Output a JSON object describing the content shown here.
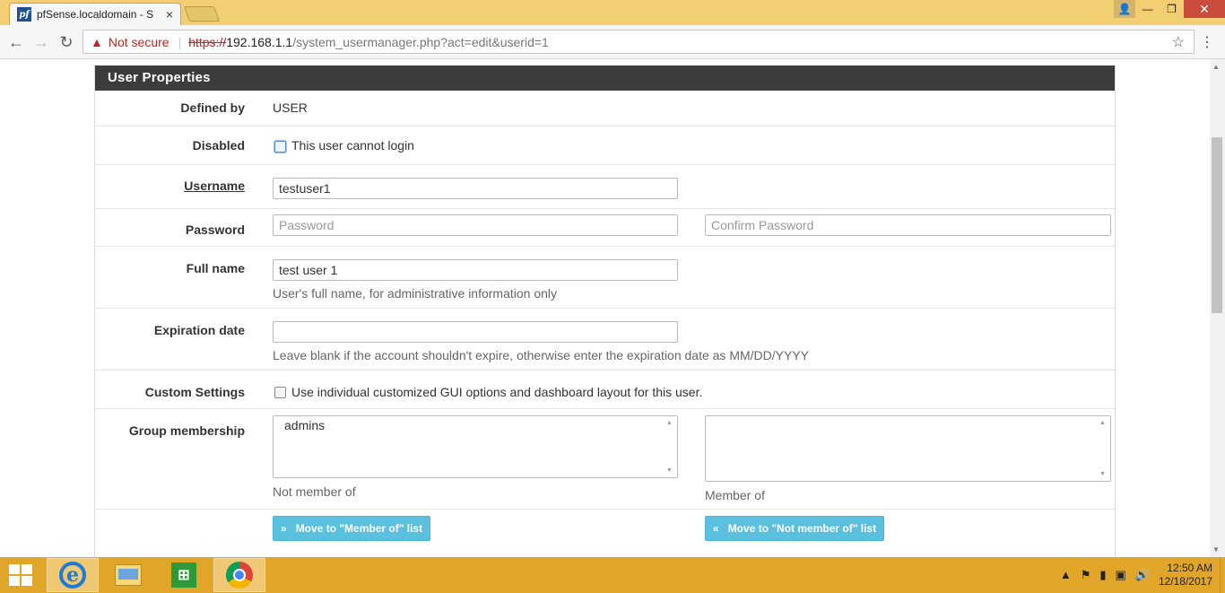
{
  "browser": {
    "tab_title": "pfSense.localdomain - Sy",
    "tab_favicon_text": "pf",
    "tab_close": "×",
    "security_label": "Not secure",
    "url_scheme": "https://",
    "url_host": "192.168.1.1",
    "url_path": "/system_usermanager.php?act=edit&userid=1",
    "icons": [
      "back-arrow-icon",
      "forward-arrow-icon",
      "reload-icon",
      "warning-icon",
      "star-icon",
      "menu-icon",
      "minimize-icon",
      "maximize-icon",
      "close-icon"
    ]
  },
  "panel": {
    "title": "User Properties",
    "defined_by": {
      "label": "Defined by",
      "value": "USER"
    },
    "disabled": {
      "label": "Disabled",
      "checkbox_label": "This user cannot login",
      "checked": false
    },
    "username": {
      "label": "Username",
      "value": "testuser1"
    },
    "password": {
      "label": "Password",
      "placeholder": "Password",
      "confirm_placeholder": "Confirm Password"
    },
    "full_name": {
      "label": "Full name",
      "value": "test user 1",
      "help": "User's full name, for administrative information only"
    },
    "expiration": {
      "label": "Expiration date",
      "value": "",
      "help": "Leave blank if the account shouldn't expire, otherwise enter the expiration date as MM/DD/YYYY"
    },
    "custom_settings": {
      "label": "Custom Settings",
      "checkbox_label": "Use individual customized GUI options and dashboard layout for this user.",
      "checked": false
    },
    "group_membership": {
      "label": "Group membership",
      "not_member_options": [
        "admins"
      ],
      "not_member_caption": "Not member of",
      "member_options": [],
      "member_caption": "Member of"
    },
    "move_to_member_btn": "Move to \"Member of\" list",
    "move_to_not_member_btn": "Move to \"Not member of\" list"
  },
  "taskbar": {
    "apps": [
      "windows-start",
      "internet-explorer",
      "file-explorer",
      "windows-store",
      "google-chrome"
    ],
    "time": "12:50 AM",
    "date": "12/18/2017"
  },
  "colors": {
    "title_bar": "#f2cf73",
    "panel_heading": "#3c3c3c",
    "button_info": "#5bc0de",
    "taskbar": "#e1a52a",
    "not_secure": "#c5221f"
  }
}
